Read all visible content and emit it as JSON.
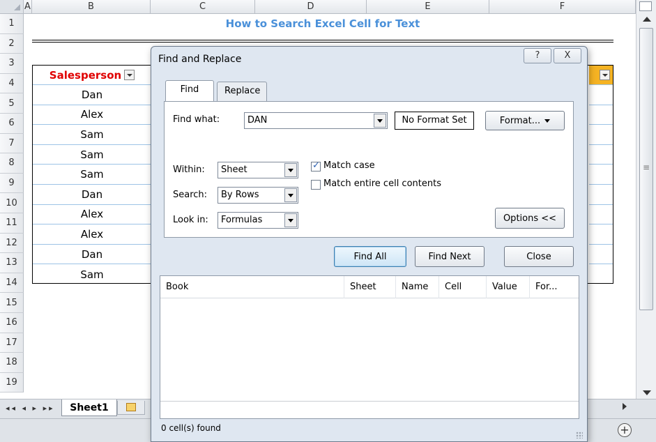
{
  "spreadsheet": {
    "columns": [
      "A",
      "B",
      "C",
      "D",
      "E",
      "F"
    ],
    "rows": [
      "1",
      "2",
      "3",
      "4",
      "5",
      "6",
      "7",
      "8",
      "9",
      "10",
      "11",
      "12",
      "13",
      "14",
      "15",
      "16",
      "17",
      "18",
      "19"
    ],
    "title": "How to Search Excel Cell for Text",
    "table_header": "Salesperson",
    "names": [
      "Dan",
      "Alex",
      "Sam",
      "Sam",
      "Sam",
      "Dan",
      "Alex",
      "Alex",
      "Dan",
      "Sam"
    ],
    "sheet_tab": "Sheet1",
    "accent_color": "#f5b323",
    "title_color": "#4a90d9",
    "header_text_color": "#e00000"
  },
  "dialog": {
    "title": "Find and Replace",
    "help_label": "?",
    "close_label": "X",
    "tabs": {
      "find": "Find",
      "replace": "Replace"
    },
    "find_what_label": "Find what:",
    "find_what_value": "DAN",
    "format_status": "No Format Set",
    "format_button": "Format...",
    "within_label": "Within:",
    "within_value": "Sheet",
    "search_label": "Search:",
    "search_value": "By Rows",
    "look_in_label": "Look in:",
    "look_in_value": "Formulas",
    "match_case_label": "Match case",
    "match_case_checked": true,
    "match_entire_label": "Match entire cell contents",
    "match_entire_checked": false,
    "options_button": "Options <<",
    "find_all_button": "Find All",
    "find_next_button": "Find Next",
    "close_button": "Close",
    "results_columns": [
      "Book",
      "Sheet",
      "Name",
      "Cell",
      "Value",
      "For..."
    ],
    "status": "0 cell(s) found"
  }
}
